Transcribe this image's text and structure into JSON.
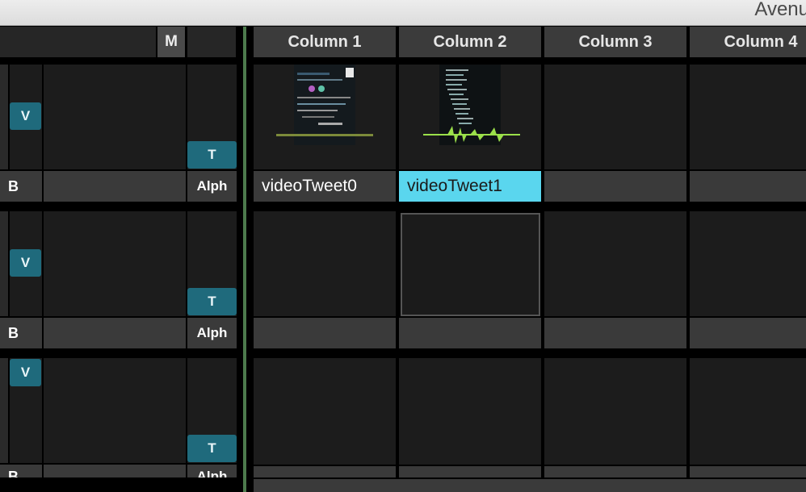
{
  "window": {
    "title_fragment": "Avenu"
  },
  "header": {
    "m_label": "M",
    "columns": [
      {
        "label": "Column 1"
      },
      {
        "label": "Column 2"
      },
      {
        "label": "Column 3"
      },
      {
        "label": "Column 4"
      }
    ]
  },
  "layers": [
    {
      "v_label": "V",
      "t_label": "T",
      "b_label": "B",
      "alpha_label": "Alph",
      "clips": [
        {
          "name": "videoTweet0",
          "selected": false
        },
        {
          "name": "videoTweet1",
          "selected": true
        },
        {
          "name": "",
          "selected": false
        },
        {
          "name": "",
          "selected": false
        }
      ]
    },
    {
      "v_label": "V",
      "t_label": "T",
      "b_label": "B",
      "alpha_label": "Alph",
      "clips": [
        {
          "name": "",
          "selected": false
        },
        {
          "name": "",
          "selected": false
        },
        {
          "name": "",
          "selected": false
        },
        {
          "name": "",
          "selected": false
        }
      ]
    },
    {
      "v_label": "V",
      "t_label": "T",
      "b_label": "B",
      "alpha_label": "Alph",
      "clips": [
        {
          "name": "",
          "selected": false
        },
        {
          "name": "",
          "selected": false
        },
        {
          "name": "",
          "selected": false
        },
        {
          "name": "",
          "selected": false
        }
      ]
    }
  ],
  "colors": {
    "accent": "#1f6a7c",
    "selection": "#5ad6ee",
    "waveform": "#9be04a"
  }
}
